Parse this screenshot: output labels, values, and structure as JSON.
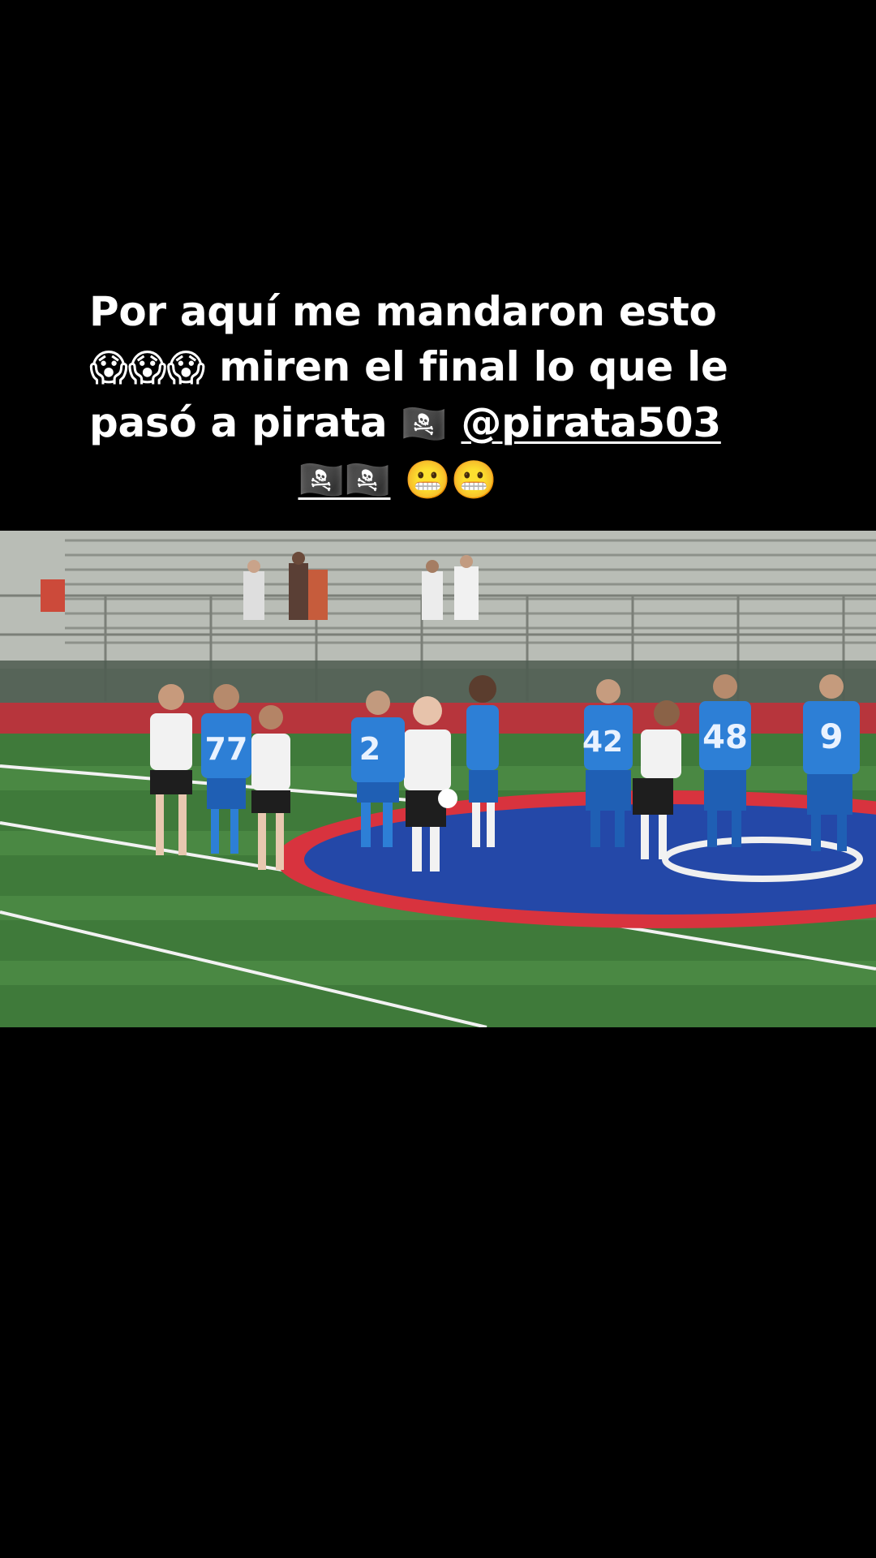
{
  "caption": {
    "line1": "Por aquí me mandaron esto",
    "line2_emoji": "😱😱😱",
    "line2_text": " miren el final lo que le",
    "line3_text": "pasó a pirata ",
    "line3_flag": "🏴‍☠️",
    "line3_mention": "@pirata503",
    "line4_flags": "🏴‍☠️🏴‍☠️",
    "line4_emoji": "😬😬"
  },
  "video": {
    "jersey_numbers": [
      "77",
      "2",
      "42",
      "48",
      "9"
    ]
  },
  "colors": {
    "background": "#000000",
    "text": "#ffffff",
    "turf": "#3f7a3a",
    "blue_kit": "#2d7fd6",
    "track_red": "#b7353c"
  }
}
